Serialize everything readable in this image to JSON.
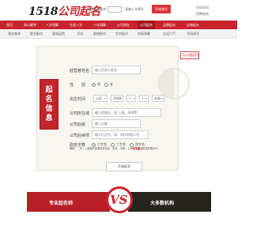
{
  "header": {
    "logo_number": "1518",
    "logo_text": "公司起名",
    "search_label": "车辆吉凶查询",
    "search_label2": "请输入车牌号",
    "search_button": "开始测试",
    "links": [
      "分机号码",
      "招聘热线"
    ]
  },
  "nav": {
    "items": [
      "首页",
      "周公解梦",
      "八字测算",
      "生辰八字",
      "十年测算",
      "公司测名",
      "公司起名",
      "品牌起名",
      "店铺起名"
    ],
    "active_index": 6
  },
  "subnav": {
    "items": [
      "基金查询",
      "姓名配对",
      "星座运势",
      "风水",
      "星座配对",
      "生肖配对",
      "时辰测算",
      "五运六气",
      "号码测试"
    ]
  },
  "form": {
    "seal_text": [
      "起",
      "名",
      "信",
      "息"
    ],
    "faq_badge": "【公司起名】",
    "owner_label": "经营者姓名",
    "owner_placeholder": "输入负责人姓名",
    "gender_label": "性　　别",
    "gender_options": [
      "男",
      "女"
    ],
    "gender_selected": "男",
    "birth_label": "出生时间",
    "calendar": "公历",
    "year": "1980",
    "month": "1",
    "day": "1",
    "hour": "未知",
    "region_label": "公司所在城",
    "region_placeholder": "输入地城名，如:上海，深圳等",
    "industry_label": "公司后缀",
    "industry_placeholder": "输入后缀",
    "product_label": "公司后续项",
    "product_placeholder": "输入行业名，如：科技有限公司",
    "length_label": "取名字数",
    "length_options": [
      "二字名",
      "三字名",
      "四字名"
    ],
    "length_selected": "二字名",
    "note_lead": "例如：",
    "note_body": "二字——鼎鼎大熊某百货商店、安全、中医、上海",
    "note_highlight": "宝宝鑫",
    "note_tail": "鑫科技有限公司",
    "submit": "开始起名"
  },
  "banner": {
    "left_text": "专业起名师",
    "vs": "VS",
    "right_text": "大多数机构"
  }
}
